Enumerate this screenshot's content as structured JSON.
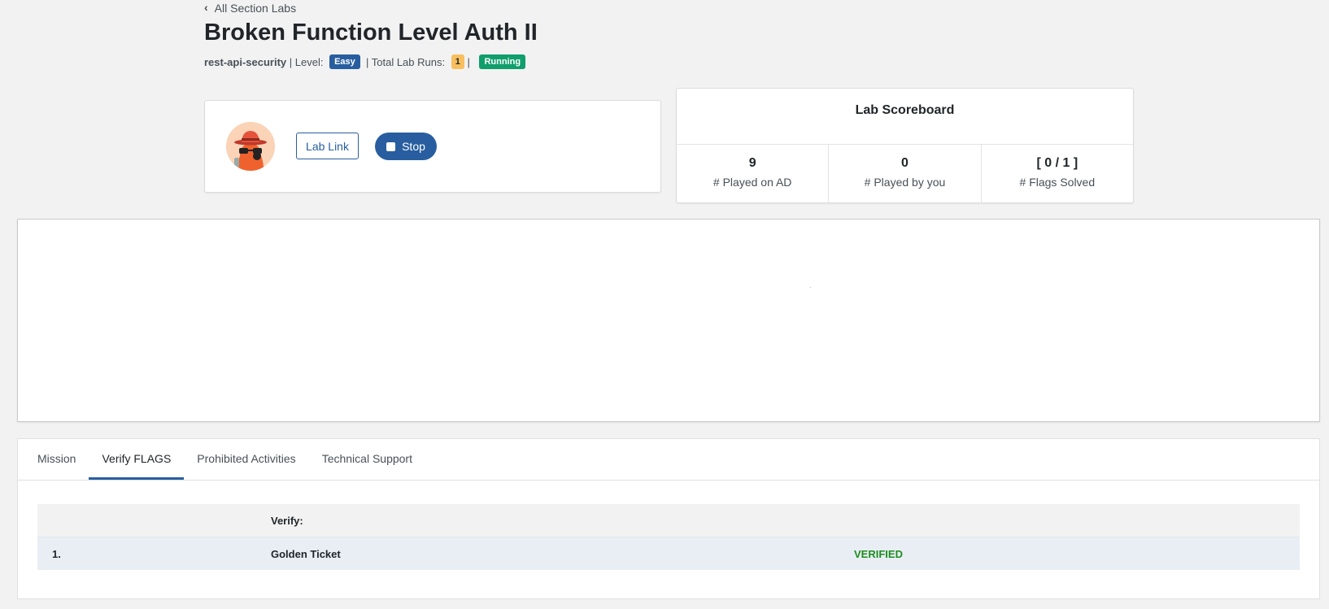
{
  "back_link": {
    "label": "All Section Labs",
    "icon": "chevron-left-icon"
  },
  "title": "Broken Function Level Auth II",
  "meta": {
    "slug": "rest-api-security",
    "level_prefix": " | Level: ",
    "level": "Easy",
    "runs_prefix": "  | Total Lab Runs: ",
    "runs": "1",
    "sep": " | ",
    "status": "Running"
  },
  "lab_card": {
    "lab_link_label": "Lab Link",
    "stop_label": "Stop",
    "avatar_icon": "hacker-avatar-icon"
  },
  "scoreboard": {
    "title": "Lab Scoreboard",
    "stats": [
      {
        "value": "9",
        "label": "# Played on AD"
      },
      {
        "value": "0",
        "label": "# Played by you"
      },
      {
        "value": "[ 0 / 1 ]",
        "label": "# Flags Solved"
      }
    ]
  },
  "tabs": [
    {
      "label": "Mission",
      "active": false
    },
    {
      "label": "Verify FLAGS",
      "active": true
    },
    {
      "label": "Prohibited Activities",
      "active": false
    },
    {
      "label": "Technical Support",
      "active": false
    }
  ],
  "verify_table": {
    "header": {
      "col1": "",
      "col2": "Verify:",
      "col3": ""
    },
    "rows": [
      {
        "num": "1.",
        "name": "Golden Ticket",
        "status": "VERIFIED"
      }
    ]
  },
  "colors": {
    "primary": "#285ea0",
    "running": "#0f9e6c",
    "runs_badge": "#f8bf5e",
    "verified": "#1e8e1e"
  }
}
